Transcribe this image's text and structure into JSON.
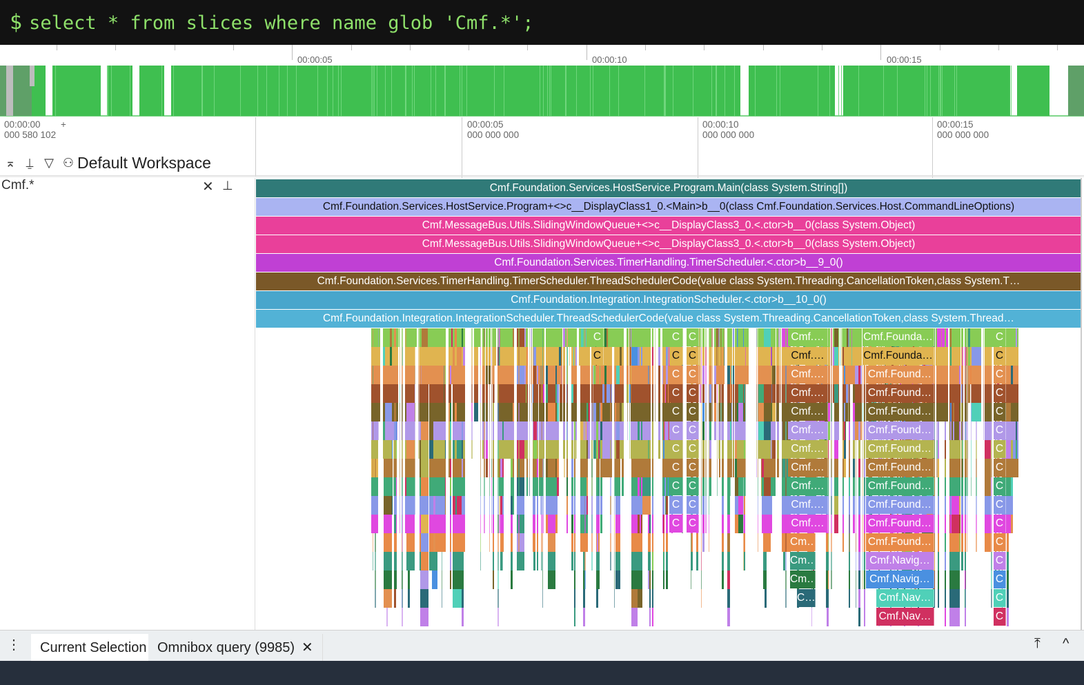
{
  "omnibox": {
    "prompt": "$",
    "query": "select * from slices where name glob 'Cmf.*';"
  },
  "overview": {
    "labels": [
      "00:00:05",
      "00:00:10",
      "00:00:15"
    ],
    "color": "#3fbf50"
  },
  "time_axis": {
    "offset_line1": "00:00:00",
    "offset_line2": "000 580 102",
    "plus": "+",
    "labels": [
      {
        "l1": "00:00:05",
        "l2": "000 000 000"
      },
      {
        "l1": "00:00:10",
        "l2": "000 000 000"
      },
      {
        "l1": "00:00:15",
        "l2": "000 000 000"
      }
    ]
  },
  "workspace": {
    "name": "Default Workspace"
  },
  "track": {
    "name": "Cmf.*",
    "close": "✕",
    "pin": "📌"
  },
  "top_slices": [
    {
      "name": "Cmf.Foundation.Services.HostService.Program.Main(class System.String[])",
      "color": "#307a78",
      "text": "#ffffff"
    },
    {
      "name": "Cmf.Foundation.Services.HostService.Program+<>c__DisplayClass1_0.<Main>b__0(class Cmf.Foundation.Services.Host.CommandLineOptions)",
      "color": "#aab4f2",
      "text": "#111111"
    },
    {
      "name": "Cmf.MessageBus.Utils.SlidingWindowQueue+<>c__DisplayClass3_0.<.ctor>b__0(class System.Object)",
      "color": "#e9409a",
      "text": "#ffffff"
    },
    {
      "name": "Cmf.MessageBus.Utils.SlidingWindowQueue+<>c__DisplayClass3_0.<.ctor>b__0(class System.Object)",
      "color": "#e9409a",
      "text": "#ffffff"
    },
    {
      "name": "Cmf.Foundation.Services.TimerHandling.TimerScheduler.<.ctor>b__9_0()",
      "color": "#c040d4",
      "text": "#ffffff"
    },
    {
      "name": "Cmf.Foundation.Services.TimerHandling.TimerScheduler.ThreadSchedulerCode(value class System.Threading.CancellationToken,class System.T…",
      "color": "#7a5828",
      "text": "#ffffff"
    },
    {
      "name": "Cmf.Foundation.Integration.IntegrationScheduler.<.ctor>b__10_0()",
      "color": "#48a6cc",
      "text": "#ffffff"
    },
    {
      "name": "Cmf.Foundation.Integration.IntegrationScheduler.ThreadSchedulerCode(value class System.Threading.CancellationToken,class System.Thread…",
      "color": "#52b2d6",
      "text": "#ffffff"
    }
  ],
  "depth_colors": [
    "#88cc55",
    "#e0b450",
    "#e39050",
    "#a0522d",
    "#78642a",
    "#b098e8",
    "#b4b450",
    "#b07a3a",
    "#40aa78",
    "#8898e8",
    "#e048e0",
    "#e88a48",
    "#3a9a80",
    "#2a7a40",
    "#2a6a78",
    "#c080e8",
    "#4a90e0",
    "#50d0b8",
    "#d03060"
  ],
  "slice_labels": {
    "c": "C",
    "cmf_short": "Cmf.…",
    "cm": "Cm…",
    "c_ell": "C…",
    "founda": "Cmf.Founda…",
    "found": "Cmf.Found…",
    "navig": "Cmf.Navig…",
    "nav": "Cmf.Nav…"
  },
  "bottom": {
    "menu": "⋮",
    "tabs": [
      {
        "label": "Current Selection"
      },
      {
        "label": "Omnibox query (9985)",
        "close": "✕"
      }
    ],
    "pin_icon": "⤒",
    "collapse_icon": "^"
  }
}
